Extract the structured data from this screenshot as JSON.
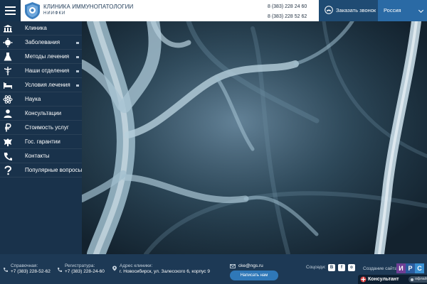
{
  "header": {
    "brand_title": "КЛИНИКА ИММУНОПАТОЛОГИИ",
    "brand_subtitle": "НИИФКИ",
    "phone_1": "8 (383) 228 24 60",
    "phone_2": "8 (383) 228 52 62",
    "callback_label": "Заказать звонок",
    "region_label": "Россия"
  },
  "sidebar": {
    "items": [
      {
        "label": "Клиника",
        "icon": "clinic-building-icon",
        "has_submenu": false
      },
      {
        "label": "Заболевания",
        "icon": "virus-icon",
        "has_submenu": true
      },
      {
        "label": "Методы лечения",
        "icon": "flask-icon",
        "has_submenu": true
      },
      {
        "label": "Наши отделения",
        "icon": "caduceus-icon",
        "has_submenu": true
      },
      {
        "label": "Условия лечения",
        "icon": "hospital-bed-icon",
        "has_submenu": true
      },
      {
        "label": "Наука",
        "icon": "atom-icon",
        "has_submenu": false
      },
      {
        "label": "Консультации",
        "icon": "doctor-icon",
        "has_submenu": false
      },
      {
        "label": "Стоимость услуг",
        "icon": "ruble-icon",
        "has_submenu": false
      },
      {
        "label": "Гос. гарантии",
        "icon": "coat-of-arms-icon",
        "has_submenu": false
      },
      {
        "label": "Контакты",
        "icon": "phone-book-icon",
        "has_submenu": false
      },
      {
        "label": "Популярные вопросы",
        "icon": "question-icon",
        "has_submenu": false
      }
    ]
  },
  "footer": {
    "info_label": "Справочная:",
    "info_phone": "+7 (383) 228-52-62",
    "reg_label": "Регистратура:",
    "reg_phone": "+7 (383) 228-24-60",
    "addr_label": "Адрес клиники:",
    "addr_value": "г. Новосибирск, ул. Залесского 6, корпус 9",
    "email": "cke@ngs.ru",
    "write_button": "Написать нам",
    "social_label": "Соцседи:",
    "social": [
      {
        "label": "В",
        "icon": "vk-icon"
      },
      {
        "label": "f",
        "icon": "facebook-icon"
      },
      {
        "label": "о",
        "icon": "odnoklassniki-icon"
      }
    ],
    "site_made_label": "Создание сайта",
    "irs_letters": [
      "И",
      "Р",
      "С"
    ],
    "irs_colors": [
      "#6e3f95",
      "#2b5c9e",
      "#3a8fd0"
    ]
  },
  "consultant": {
    "label": "Консультант",
    "status": "офлайн"
  },
  "colors": {
    "accent": "#2a6aa5",
    "sidebar": "#19324b",
    "footer": "#1d3955"
  }
}
